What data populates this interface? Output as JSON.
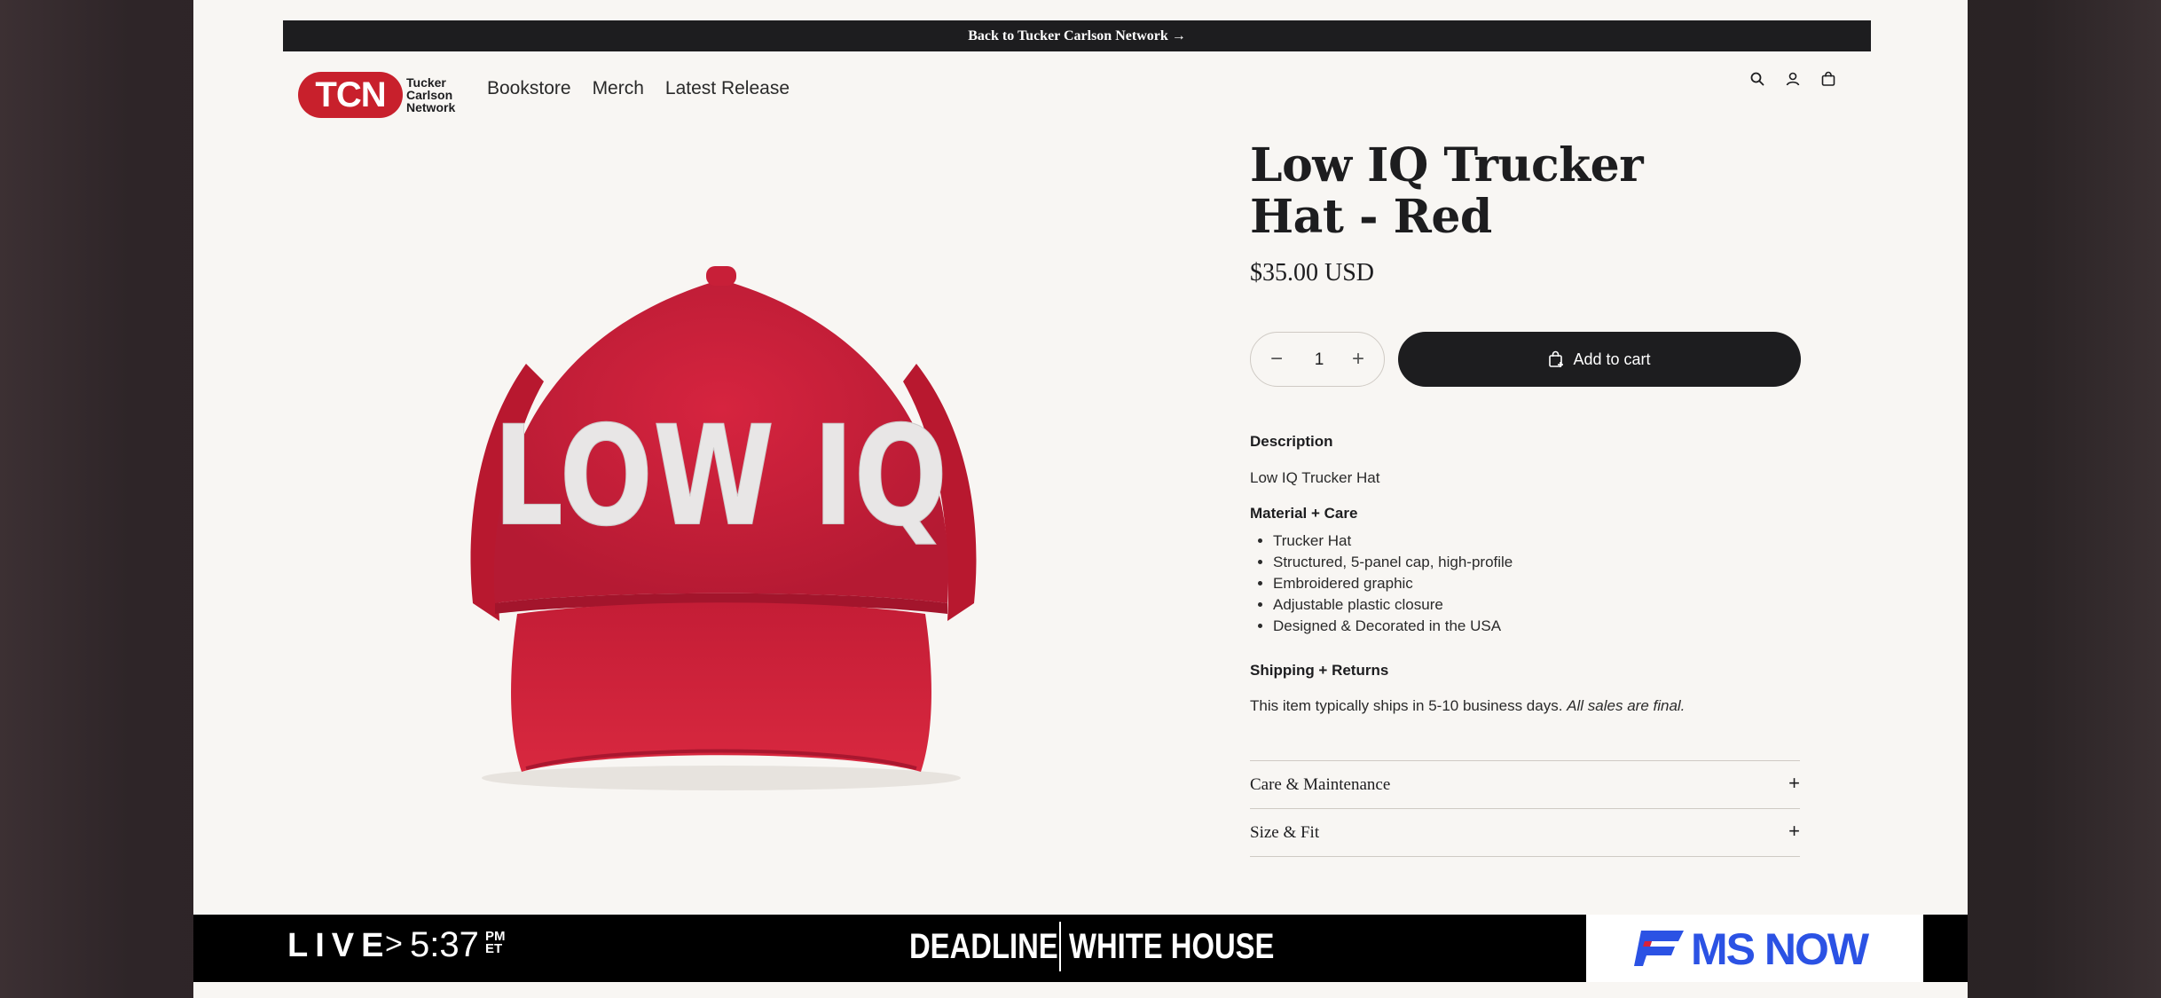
{
  "announcement": "Back to Tucker Carlson Network →",
  "logo": {
    "badge": "TCN",
    "lines": [
      "Tucker",
      "Carlson",
      "Network"
    ]
  },
  "nav": [
    "Bookstore",
    "Merch",
    "Latest Release"
  ],
  "header_icons": [
    "search-icon",
    "account-icon",
    "cart-icon"
  ],
  "product": {
    "hat_text": "LOW IQ",
    "hat_color": "#cc1f3c",
    "title": "Low IQ Trucker Hat - Red",
    "price": "$35.00 USD",
    "quantity": "1",
    "qty_minus": "−",
    "qty_plus": "+",
    "add_to_cart": "Add to cart"
  },
  "description": {
    "heading": "Description",
    "text": "Low IQ Trucker Hat",
    "material_heading": "Material + Care",
    "features": [
      "Trucker Hat",
      "Structured, 5-panel cap, high-profile",
      "Embroidered graphic",
      "Adjustable plastic closure",
      "Designed & Decorated in the USA"
    ],
    "shipping_heading": "Shipping + Returns",
    "shipping_text": "This item typically ships in 5-10 business days.",
    "shipping_note": "All sales are final."
  },
  "accordions": [
    {
      "label": "Care & Maintenance",
      "icon": "+"
    },
    {
      "label": "Size & Fit",
      "icon": "+"
    }
  ],
  "chyron": {
    "live": "LIVE",
    "chevron": ">",
    "time": "5:37",
    "ampm": "PM",
    "tz": "ET",
    "show_part1": "DEADLINE",
    "show_part2": "WHITE HOUSE",
    "network": "MS NOW",
    "network_color": "#2b52e4"
  }
}
